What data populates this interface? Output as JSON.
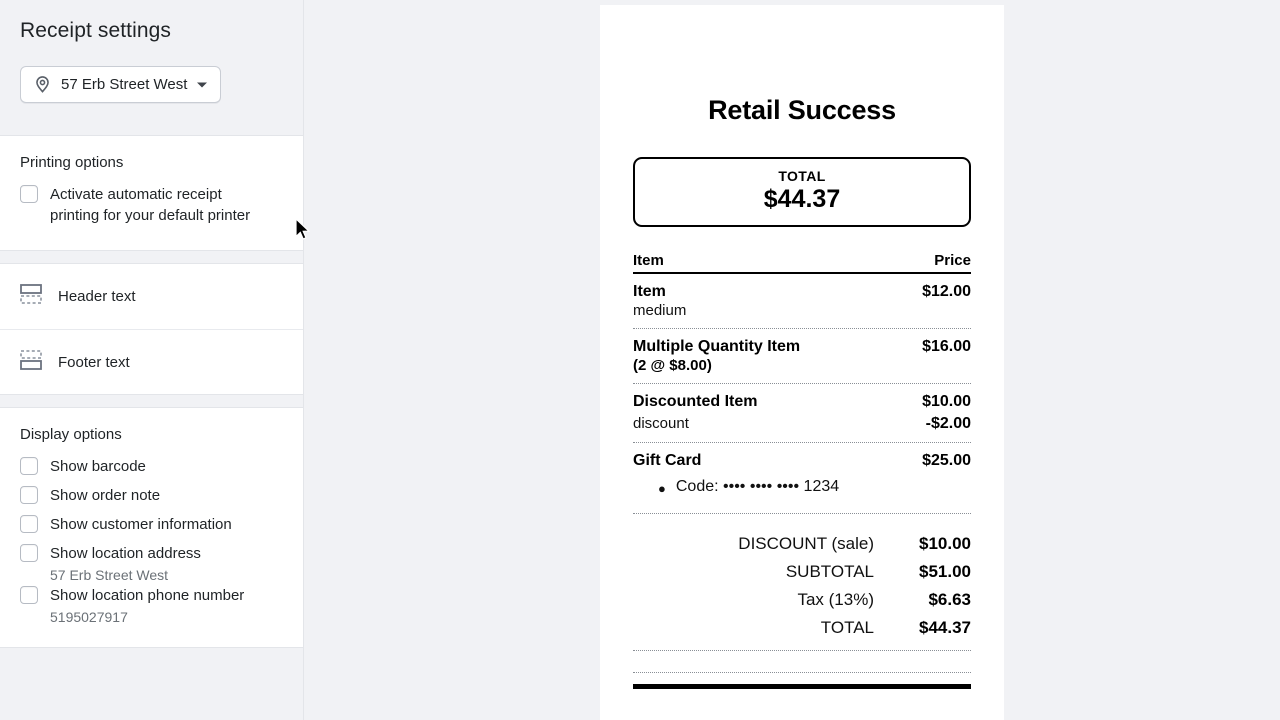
{
  "sidebar": {
    "title": "Receipt settings",
    "location_picker": {
      "value": "57 Erb Street West",
      "pin_icon": "map-pin-icon",
      "caret_icon": "chevron-down-icon"
    },
    "printing": {
      "section_label": "Printing options",
      "option": {
        "label": "Activate automatic receipt printing for your default printer",
        "checked": false
      }
    },
    "text_rows": [
      {
        "label": "Header text",
        "icon": "header-text-icon"
      },
      {
        "label": "Footer text",
        "icon": "footer-text-icon"
      }
    ],
    "display": {
      "section_label": "Display options",
      "options": [
        {
          "label": "Show barcode",
          "checked": false,
          "sub": ""
        },
        {
          "label": "Show order note",
          "checked": false,
          "sub": ""
        },
        {
          "label": "Show customer information",
          "checked": false,
          "sub": ""
        },
        {
          "label": "Show location address",
          "checked": false,
          "sub": "57 Erb Street West"
        },
        {
          "label": "Show location phone number",
          "checked": false,
          "sub": "5195027917"
        }
      ]
    }
  },
  "receipt": {
    "store_name": "Retail Success",
    "total_box": {
      "label": "TOTAL",
      "amount": "$44.37"
    },
    "columns": {
      "item": "Item",
      "price": "Price"
    },
    "line_items": [
      {
        "name": "Item",
        "price": "$12.00",
        "variant": "medium",
        "qty_note": "",
        "discount_label": "",
        "discount_amount": ""
      },
      {
        "name": "Multiple Quantity Item",
        "price": "$16.00",
        "variant": "",
        "qty_note": "(2 @ $8.00)",
        "discount_label": "",
        "discount_amount": ""
      },
      {
        "name": "Discounted Item",
        "price": "$10.00",
        "variant": "",
        "qty_note": "",
        "discount_label": "discount",
        "discount_amount": "-$2.00"
      },
      {
        "name": "Gift Card",
        "price": "$25.00",
        "variant": "",
        "qty_note": "",
        "discount_label": "",
        "discount_amount": ""
      }
    ],
    "gift_card_code": "Code: •••• •••• •••• 1234",
    "totals": [
      {
        "label": "DISCOUNT (sale)",
        "amount": "$10.00"
      },
      {
        "label": "SUBTOTAL",
        "amount": "$51.00"
      },
      {
        "label": "Tax (13%)",
        "amount": "$6.63"
      },
      {
        "label": "TOTAL",
        "amount": "$44.37"
      }
    ]
  },
  "colors": {
    "page_background": "#f1f2f5",
    "card_background": "#ffffff",
    "text_primary": "#1f2326",
    "text_muted": "#6b7177",
    "border": "#e3e5e9",
    "receipt_ink": "#000000"
  }
}
